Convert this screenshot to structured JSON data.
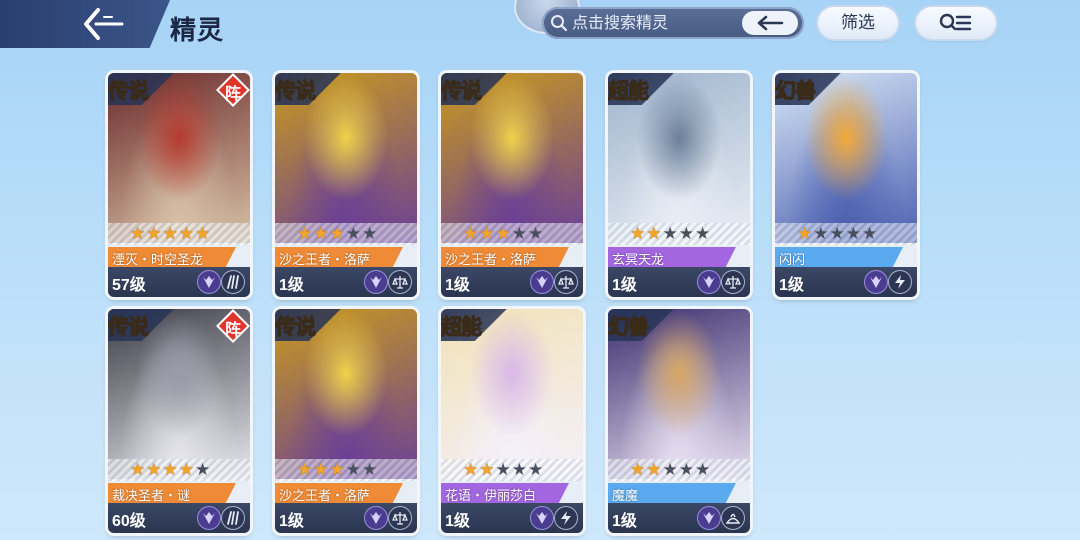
{
  "header": {
    "title": "精灵",
    "search_placeholder": "点击搜索精灵",
    "filter_label": "筛选"
  },
  "colors": {
    "legend": "#f7a63a",
    "super": "#b06ee6",
    "beast": "#3b8ee8",
    "band_orange": "#ef8a36",
    "band_purple": "#a366e0",
    "band_blue": "#5aaaf0"
  },
  "cards": [
    {
      "tier": "传说",
      "formation": "阵",
      "stars": 5,
      "name": "湮灭・时空圣龙",
      "level": "57级",
      "type_icons": [
        "mech-icon",
        "claw-icon"
      ]
    },
    {
      "tier": "传说",
      "stars": 3,
      "name": "沙之王者・洛萨",
      "level": "1级",
      "type_icons": [
        "mech-icon",
        "scale-icon"
      ]
    },
    {
      "tier": "传说",
      "stars": 3,
      "name": "沙之王者・洛萨",
      "level": "1级",
      "type_icons": [
        "mech-icon",
        "scale-icon"
      ]
    },
    {
      "tier": "超能",
      "stars": 2,
      "name": "玄冥天龙",
      "level": "1级",
      "type_icons": [
        "mech-icon",
        "scale-icon"
      ]
    },
    {
      "tier": "幻兽",
      "stars": 1,
      "name": "闪闪",
      "level": "1级",
      "type_icons": [
        "mech-icon",
        "lightning-icon"
      ]
    },
    {
      "tier": "传说",
      "formation": "阵",
      "stars": 4,
      "name": "裁决圣者・谜",
      "level": "60级",
      "type_icons": [
        "mech-icon",
        "claw-icon"
      ]
    },
    {
      "tier": "传说",
      "stars": 3,
      "name": "沙之王者・洛萨",
      "level": "1级",
      "type_icons": [
        "mech-icon",
        "scale-icon"
      ]
    },
    {
      "tier": "超能",
      "stars": 2,
      "name": "花语・伊丽莎白",
      "level": "1级",
      "type_icons": [
        "mech-icon",
        "lightning-icon"
      ]
    },
    {
      "tier": "幻兽",
      "stars": 2,
      "name": "魔魔",
      "level": "1级",
      "type_icons": [
        "mech-icon",
        "shadow-icon"
      ]
    }
  ]
}
